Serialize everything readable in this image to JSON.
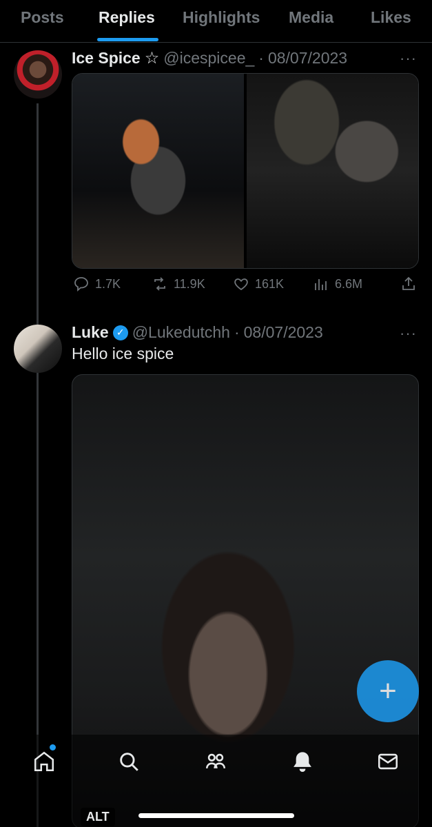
{
  "tabs": [
    "Posts",
    "Replies",
    "Highlights",
    "Media",
    "Likes"
  ],
  "active_tab": "Replies",
  "posts": [
    {
      "name": "Ice Spice",
      "badge": "☆",
      "handle": "@icespicee_",
      "separator": "·",
      "date": "08/07/2023",
      "more": "···",
      "stats": {
        "replies": "1.7K",
        "reposts": "11.9K",
        "likes": "161K",
        "views": "6.6M"
      }
    },
    {
      "name": "Luke",
      "verified": "✓",
      "handle": "@Lukedutchh",
      "separator": "·",
      "date": "08/07/2023",
      "more": "···",
      "text": "Hello ice spice"
    }
  ],
  "fab_label": "+",
  "alt_label": "ALT",
  "icons": {
    "reply": "reply-icon",
    "repost": "repost-icon",
    "like": "heart-icon",
    "views": "views-icon",
    "share": "share-icon",
    "home": "home-icon",
    "search": "search-icon",
    "communities": "communities-icon",
    "notifications": "bell-icon",
    "messages": "mail-icon"
  },
  "colors": {
    "accent": "#1d9bf0",
    "muted": "#71767b",
    "text": "#e7e9ea",
    "background": "#000000"
  }
}
